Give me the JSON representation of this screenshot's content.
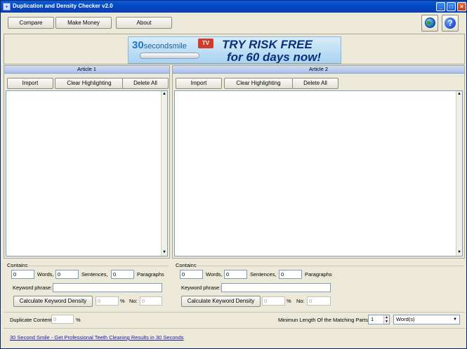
{
  "window": {
    "title": "Duplication and Density Checker v2.0",
    "controls": {
      "minimize": "_",
      "maximize": "□",
      "close": "×"
    }
  },
  "toolbar": {
    "compare_label": "Compare",
    "make_money_label": "Make Money",
    "about_label": "About",
    "globe_icon": "globe-icon",
    "help_icon": "help-icon",
    "help_glyph": "?"
  },
  "banner": {
    "logo_text": "30",
    "logo_text_small": "secondsmile",
    "tv_badge": "TV",
    "headline_line1": "TRY RISK FREE",
    "headline_line2": "for 60 days now!"
  },
  "article1": {
    "header": "Article 1",
    "import_label": "Import",
    "clear_label": "Clear Highlighting",
    "delete_label": "Delete All",
    "text": ""
  },
  "article2": {
    "header": "Article 2",
    "import_label": "Import",
    "clear_label": "Clear Highlighting",
    "delete_label": "Delete All",
    "text": ""
  },
  "stats1": {
    "contains_label": "Contains",
    "words_value": "0",
    "words_label": "Words,",
    "sentences_value": "0",
    "sentences_label": "Sentences,",
    "paragraphs_value": "0",
    "paragraphs_label": "Paragraphs",
    "keyword_label": "Keyword phrase:",
    "keyword_value": "",
    "calc_label": "Calculate Keyword Density",
    "density_value": "0",
    "percent_label": "%",
    "no_label": "No:",
    "no_value": "0"
  },
  "stats2": {
    "contains_label": "Contains",
    "words_value": "0",
    "words_label": "Words,",
    "sentences_value": "0",
    "sentences_label": "Sentences,",
    "paragraphs_value": "0",
    "paragraphs_label": "Paragraphs",
    "keyword_label": "Keyword phrase:",
    "keyword_value": "",
    "calc_label": "Calculate Keyword Density",
    "density_value": "0",
    "percent_label": "%",
    "no_label": "No:",
    "no_value": "0"
  },
  "bottom": {
    "duplicate_label": "Duplicate Content",
    "duplicate_value": "0",
    "duplicate_unit": "%",
    "min_length_label": "Minimun Length Of the Matching Parts =",
    "min_length_value": "1",
    "unit_select": "Word(s)"
  },
  "footer": {
    "link_text": "30 Second Smile - Get Professional Teeth Cleaning Results in 30 Seconds"
  }
}
